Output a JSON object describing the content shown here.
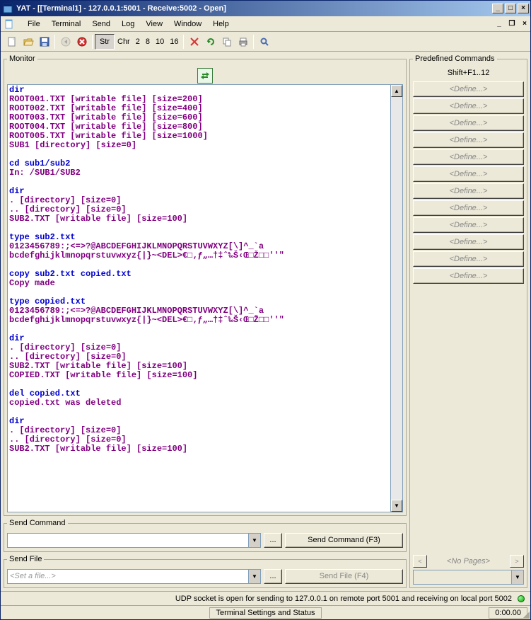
{
  "title": "YAT - [[Terminal1] - 127.0.0.1:5001 - Receive:5002 - Open]",
  "menu": {
    "file": "File",
    "terminal": "Terminal",
    "send": "Send",
    "log": "Log",
    "view": "View",
    "window": "Window",
    "help": "Help"
  },
  "toolbar": {
    "str_label": "Str",
    "chr_label": "Chr",
    "r2": "2",
    "r8": "8",
    "r10": "10",
    "r16": "16"
  },
  "monitor": {
    "legend": "Monitor",
    "lines": [
      {
        "type": "cmd",
        "text": "dir"
      },
      {
        "type": "out",
        "text": "ROOT001.TXT [writable file] [size=200]"
      },
      {
        "type": "out",
        "text": "ROOT002.TXT [writable file] [size=400]"
      },
      {
        "type": "out",
        "text": "ROOT003.TXT [writable file] [size=600]"
      },
      {
        "type": "out",
        "text": "ROOT004.TXT [writable file] [size=800]"
      },
      {
        "type": "out",
        "text": "ROOT005.TXT [writable file] [size=1000]"
      },
      {
        "type": "out",
        "text": "SUB1 [directory] [size=0]"
      },
      {
        "type": "blank",
        "text": ""
      },
      {
        "type": "cmd",
        "text": "cd sub1/sub2"
      },
      {
        "type": "out",
        "text": "In: /SUB1/SUB2"
      },
      {
        "type": "blank",
        "text": ""
      },
      {
        "type": "cmd",
        "text": "dir"
      },
      {
        "type": "out",
        "text": ". [directory] [size=0]"
      },
      {
        "type": "out",
        "text": ".. [directory] [size=0]"
      },
      {
        "type": "out",
        "text": "SUB2.TXT [writable file] [size=100]"
      },
      {
        "type": "blank",
        "text": ""
      },
      {
        "type": "cmd",
        "text": "type sub2.txt"
      },
      {
        "type": "out",
        "text": "0123456789:;<=>?@ABCDEFGHIJKLMNOPQRSTUVWXYZ[\\]^_`a"
      },
      {
        "type": "out",
        "text": "bcdefghijklmnopqrstuvwxyz{|}~<DEL>€□‚ƒ„…†‡ˆ‰Š‹Œ□Ž□□''\""
      },
      {
        "type": "blank",
        "text": ""
      },
      {
        "type": "cmd",
        "text": "copy sub2.txt copied.txt"
      },
      {
        "type": "out",
        "text": "Copy made"
      },
      {
        "type": "blank",
        "text": ""
      },
      {
        "type": "cmd",
        "text": "type copied.txt"
      },
      {
        "type": "out",
        "text": "0123456789:;<=>?@ABCDEFGHIJKLMNOPQRSTUVWXYZ[\\]^_`a"
      },
      {
        "type": "out",
        "text": "bcdefghijklmnopqrstuvwxyz{|}~<DEL>€□‚ƒ„…†‡ˆ‰Š‹Œ□Ž□□''\""
      },
      {
        "type": "blank",
        "text": ""
      },
      {
        "type": "cmd",
        "text": "dir"
      },
      {
        "type": "out",
        "text": ". [directory] [size=0]"
      },
      {
        "type": "out",
        "text": ".. [directory] [size=0]"
      },
      {
        "type": "out",
        "text": "SUB2.TXT [writable file] [size=100]"
      },
      {
        "type": "out",
        "text": "COPIED.TXT [writable file] [size=100]"
      },
      {
        "type": "blank",
        "text": ""
      },
      {
        "type": "cmd",
        "text": "del copied.txt"
      },
      {
        "type": "out",
        "text": "copied.txt was deleted"
      },
      {
        "type": "blank",
        "text": ""
      },
      {
        "type": "cmd",
        "text": "dir"
      },
      {
        "type": "out",
        "text": ". [directory] [size=0]"
      },
      {
        "type": "out",
        "text": ".. [directory] [size=0]"
      },
      {
        "type": "out",
        "text": "SUB2.TXT [writable file] [size=100]"
      }
    ]
  },
  "send_command": {
    "legend": "Send Command",
    "value": "",
    "browse": "...",
    "button": "Send Command (F3)"
  },
  "send_file": {
    "legend": "Send File",
    "placeholder": "<Set a file...>",
    "browse": "...",
    "button": "Send File (F4)"
  },
  "predefined": {
    "legend": "Predefined Commands",
    "shortcut": "Shift+F1..12",
    "define_label": "<Define...>",
    "count": 12,
    "pager": {
      "prev": "<",
      "label": "<No Pages>",
      "next": ">"
    }
  },
  "status": {
    "text": "UDP socket is open for sending to 127.0.0.1 on remote port 5001 and receiving on local port 5002",
    "panel": "Terminal Settings and Status",
    "time": "0:00.00"
  }
}
